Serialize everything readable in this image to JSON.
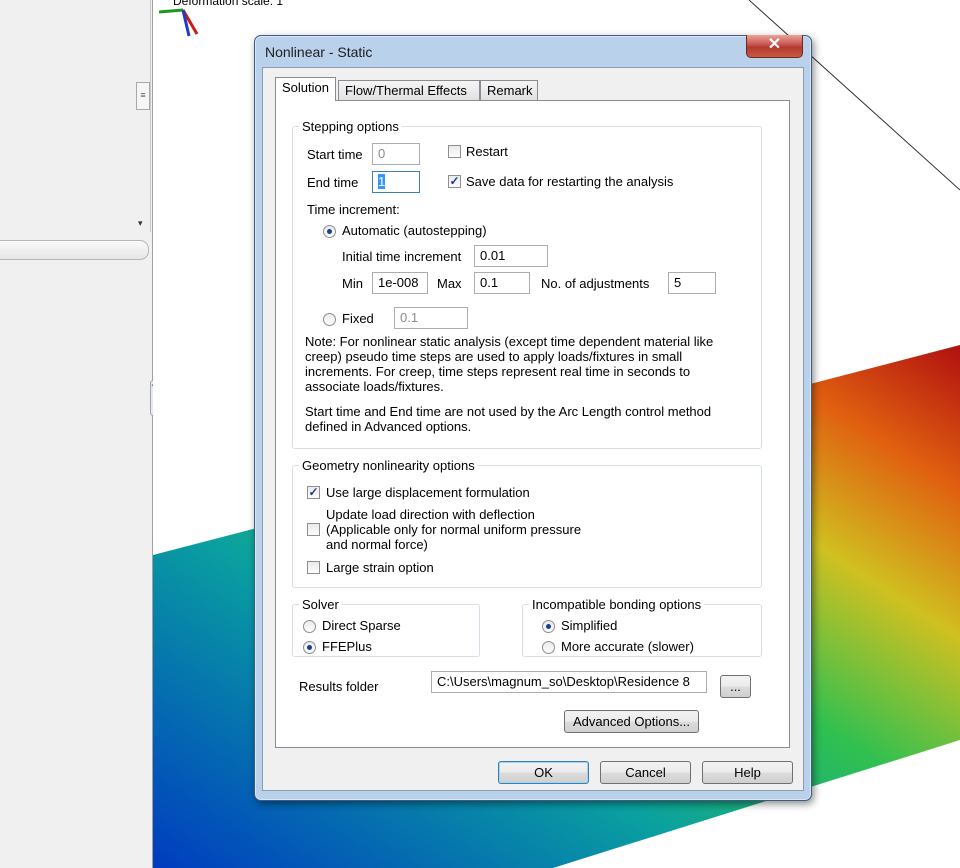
{
  "background": {
    "deformation_label": "Deformation scale: 1",
    "left_panel_grip": "≡",
    "scroll_arrow": "▾",
    "collapse_handle": "<<"
  },
  "dialog": {
    "title": "Nonlinear - Static",
    "close_glyph": "✕",
    "tabs": [
      "Solution",
      "Flow/Thermal Effects",
      "Remark"
    ],
    "stepping": {
      "legend": "Stepping options",
      "start_time_label": "Start time",
      "start_time_value": "0",
      "end_time_label": "End time",
      "end_time_value": "1",
      "restart_label": "Restart",
      "restart_checked": false,
      "save_label": "Save data for restarting the analysis",
      "save_checked": true,
      "time_increment_label": "Time increment:",
      "automatic_label": "Automatic (autostepping)",
      "automatic_selected": true,
      "initial_increment_label": "Initial time increment",
      "initial_increment_value": "0.01",
      "min_label": "Min",
      "min_value": "1e-008",
      "max_label": "Max",
      "max_value": "0.1",
      "adjustments_label": "No. of adjustments",
      "adjustments_value": "5",
      "fixed_label": "Fixed",
      "fixed_value": "0.1",
      "note_1": "Note: For nonlinear static analysis (except time dependent material like creep) pseudo time steps are used to apply loads/fixtures in small increments. For creep, time steps represent real time in seconds to associate loads/fixtures.",
      "note_2": "Start time and End time  are not used by the Arc Length control method defined in Advanced options."
    },
    "geometry": {
      "legend": "Geometry nonlinearity options",
      "large_displacement_label": "Use large displacement formulation",
      "large_displacement_checked": true,
      "update_load_line1": "Update load direction with deflection",
      "update_load_line2": "(Applicable only for normal uniform pressure",
      "update_load_line3": "and normal force)",
      "update_load_checked": false,
      "large_strain_label": "Large strain option",
      "large_strain_checked": false
    },
    "solver": {
      "legend": "Solver",
      "options": [
        "Direct Sparse",
        "FFEPlus"
      ],
      "selected": "FFEPlus"
    },
    "bonding": {
      "legend": "Incompatible bonding options",
      "options": [
        "Simplified",
        "More accurate (slower)"
      ],
      "selected": "Simplified"
    },
    "results_folder_label": "Results folder",
    "results_folder_value": "C:\\Users\\magnum_so\\Desktop\\Residence 8",
    "browse_label": "...",
    "advanced_label": "Advanced Options...",
    "ok_label": "OK",
    "cancel_label": "Cancel",
    "help_label": "Help"
  },
  "colors": {
    "dialog_frame": "#b9d1ea",
    "checkmark": "#1c3f94",
    "mesh_blue": "#0050c8",
    "mesh_green": "#22c060",
    "mesh_red": "#c81e0a"
  }
}
